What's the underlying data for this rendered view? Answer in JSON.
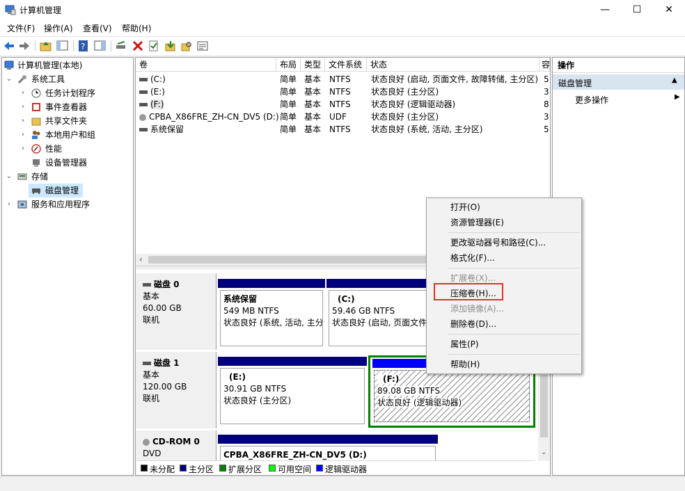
{
  "window": {
    "title": "计算机管理"
  },
  "menu": [
    "文件(F)",
    "操作(A)",
    "查看(V)",
    "帮助(H)"
  ],
  "tree": [
    {
      "label": "计算机管理(本地)",
      "level": 0,
      "exp": ""
    },
    {
      "label": "系统工具",
      "level": 1,
      "exp": "⌄"
    },
    {
      "label": "任务计划程序",
      "level": 2,
      "exp": "›"
    },
    {
      "label": "事件查看器",
      "level": 2,
      "exp": "›"
    },
    {
      "label": "共享文件夹",
      "level": 2,
      "exp": "›"
    },
    {
      "label": "本地用户和组",
      "level": 2,
      "exp": "›"
    },
    {
      "label": "性能",
      "level": 2,
      "exp": "›"
    },
    {
      "label": "设备管理器",
      "level": 2,
      "exp": ""
    },
    {
      "label": "存储",
      "level": 1,
      "exp": "⌄"
    },
    {
      "label": "磁盘管理",
      "level": 2,
      "exp": "",
      "selected": true
    },
    {
      "label": "服务和应用程序",
      "level": 1,
      "exp": "›"
    }
  ],
  "columns": [
    "卷",
    "布局",
    "类型",
    "文件系统",
    "状态",
    "容"
  ],
  "volumes": [
    {
      "name": "(C:)",
      "layout": "简单",
      "type": "基本",
      "fs": "NTFS",
      "status": "状态良好 (启动, 页面文件, 故障转储, 主分区)",
      "cap": "5"
    },
    {
      "name": "(E:)",
      "layout": "简单",
      "type": "基本",
      "fs": "NTFS",
      "status": "状态良好 (主分区)",
      "cap": "3"
    },
    {
      "name": "(F:)",
      "layout": "简单",
      "type": "基本",
      "fs": "NTFS",
      "status": "状态良好 (逻辑驱动器)",
      "cap": "8"
    },
    {
      "name": "CPBA_X86FRE_ZH-CN_DV5 (D:)",
      "layout": "简单",
      "type": "基本",
      "fs": "UDF",
      "status": "状态良好 (主分区)",
      "cap": "3"
    },
    {
      "name": "系统保留",
      "layout": "简单",
      "type": "基本",
      "fs": "NTFS",
      "status": "状态良好 (系统, 活动, 主分区)",
      "cap": "5"
    }
  ],
  "disks": {
    "disk0": {
      "name": "磁盘 0",
      "kind": "基本",
      "size": "60.00 GB",
      "state": "联机"
    },
    "disk1": {
      "name": "磁盘 1",
      "kind": "基本",
      "size": "120.00 GB",
      "state": "联机"
    },
    "cdrom": {
      "name": "CD-ROM 0",
      "kind": "DVD"
    }
  },
  "partitions": {
    "sysres": {
      "name": "系统保留",
      "size": "549 MB NTFS",
      "status": "状态良好 (系统, 活动, 主分区"
    },
    "c": {
      "name": "(C:)",
      "size": "59.46 GB NTFS",
      "status": "状态良好 (启动, 页面文件"
    },
    "e": {
      "name": "(E:)",
      "size": "30.91 GB NTFS",
      "status": "状态良好 (主分区)"
    },
    "f": {
      "name": "(F:)",
      "size": "89.08 GB NTFS",
      "status": "状态良好 (逻辑驱动器)"
    },
    "d": {
      "name": "CPBA_X86FRE_ZH-CN_DV5  (D:)"
    }
  },
  "legend": [
    "未分配",
    "主分区",
    "扩展分区",
    "可用空间",
    "逻辑驱动器"
  ],
  "colors": {
    "unallocated": "#000000",
    "primary": "#00007c",
    "extended": "#008000",
    "free": "#00ff00",
    "logical": "#0000ff",
    "highlight": "#e0332e"
  },
  "actions": {
    "header": "操作",
    "section": "磁盘管理",
    "more": "更多操作"
  },
  "context_menu": {
    "open": "打开(O)",
    "explorer": "资源管理器(E)",
    "change_letter": "更改驱动器号和路径(C)...",
    "format": "格式化(F)...",
    "extend": "扩展卷(X)...",
    "shrink": "压缩卷(H)...",
    "mirror": "添加镜像(A)...",
    "delete": "删除卷(D)...",
    "properties": "属性(P)",
    "help": "帮助(H)"
  }
}
